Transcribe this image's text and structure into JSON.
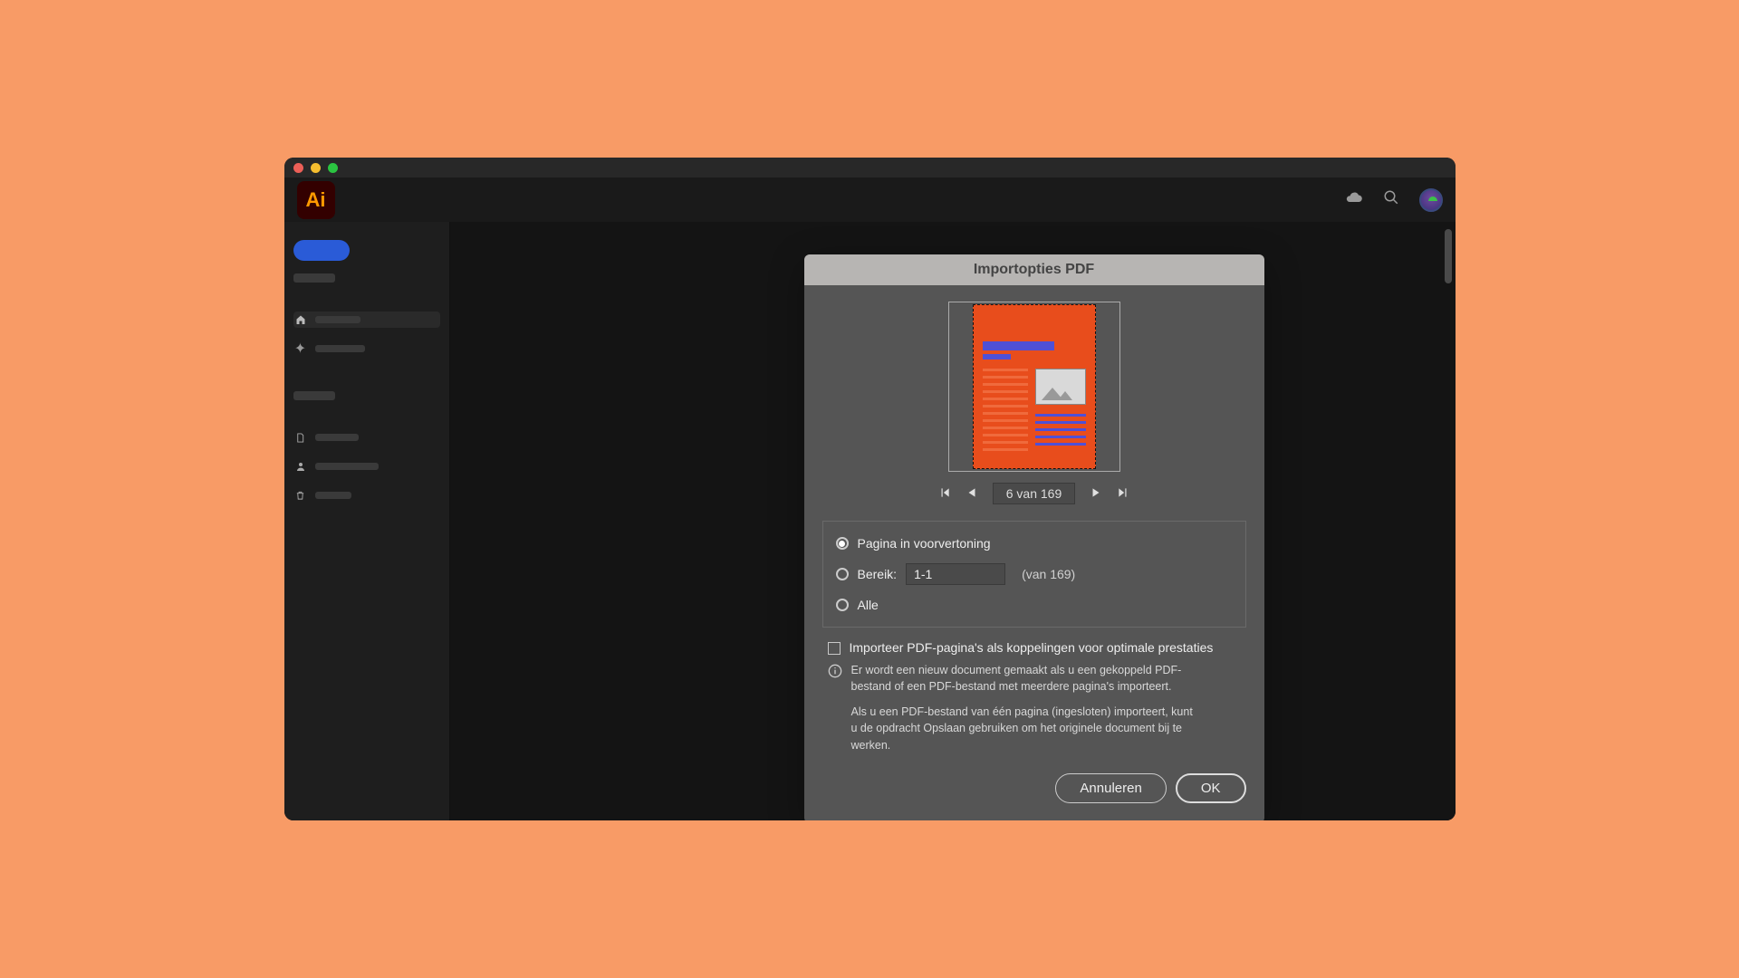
{
  "app": {
    "logo": "Ai"
  },
  "dialog": {
    "title": "Importopties PDF",
    "pager": {
      "current": "6",
      "sep": "van",
      "total": "169"
    },
    "options": {
      "preview_label": "Pagina in voorvertoning",
      "range_label": "Bereik:",
      "range_value": "1-1",
      "range_hint": "(van 169)",
      "all_label": "Alle"
    },
    "link_checkbox_label": "Importeer PDF-pagina's als koppelingen voor optimale prestaties",
    "info_p1": "Er wordt een nieuw document gemaakt als u een gekoppeld PDF-bestand of een PDF-bestand met meerdere pagina's importeert.",
    "info_p2": "Als u een PDF-bestand van één pagina (ingesloten) importeert, kunt u de opdracht Opslaan gebruiken om het originele document bij te werken.",
    "cancel": "Annuleren",
    "ok": "OK"
  }
}
